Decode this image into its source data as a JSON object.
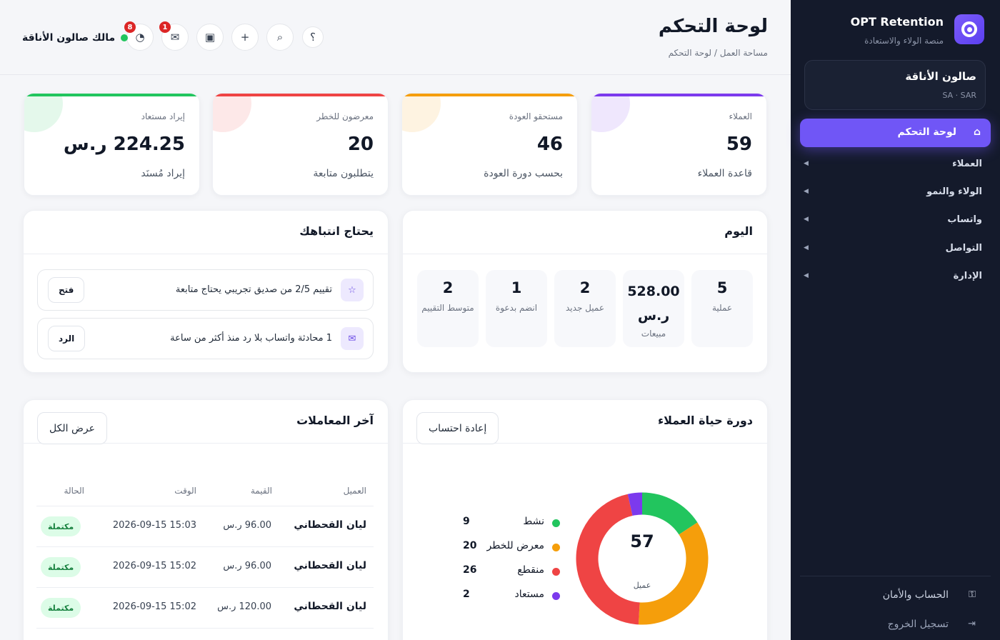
{
  "sidebar": {
    "brand_name": "OPT Retention",
    "brand_sub": "منصة الولاء والاستعادة",
    "salon_name": "صالون الأناقة",
    "salon_meta": "SA · SAR",
    "active_item": "لوحة التحكم",
    "items": [
      {
        "label": "العملاء"
      },
      {
        "label": "الولاء والنمو"
      },
      {
        "label": "واتساب"
      },
      {
        "label": "التواصل"
      },
      {
        "label": "الإدارة"
      }
    ],
    "account": "الحساب والأمان",
    "logout": "تسجيل الخروج"
  },
  "header": {
    "title": "لوحة التحكم",
    "breadcrumb": "مساحة العمل / لوحة التحكم",
    "user": "مالك صالون الأناقة",
    "badges": {
      "reports": "8",
      "mail": "1"
    }
  },
  "stats": [
    {
      "label": "العملاء",
      "value": "59",
      "sub": "قاعدة العملاء",
      "color": "#7c3aed"
    },
    {
      "label": "مستحقو العودة",
      "value": "46",
      "sub": "بحسب دورة العودة",
      "color": "#f59e0b"
    },
    {
      "label": "معرضون للخطر",
      "value": "20",
      "sub": "يتطلبون متابعة",
      "color": "#ef4444"
    },
    {
      "label": "إيراد مستعاد",
      "value": "224.25 ر.س",
      "sub": "إيراد مُسنَد",
      "color": "#22c55e"
    }
  ],
  "today": {
    "title": "اليوم",
    "tiles": [
      {
        "value": "5",
        "label": "عملية"
      },
      {
        "value": "528.00 ر.س",
        "label": "مبيعات"
      },
      {
        "value": "2",
        "label": "عميل جديد"
      },
      {
        "value": "1",
        "label": "انضم بدعوة"
      },
      {
        "value": "2",
        "label": "متوسط التقييم"
      }
    ]
  },
  "attention": {
    "title": "يحتاج انتباهك",
    "items": [
      {
        "text": "تقييم 2/5 من صديق تجريبي يحتاج متابعة",
        "action": "فتح",
        "icon": "star-icon"
      },
      {
        "text": "1 محادثة واتساب بلا رد منذ أكثر من ساعة",
        "action": "الرد",
        "icon": "mail-icon"
      }
    ]
  },
  "lifecycle": {
    "title": "دورة حياة العملاء",
    "button": "إعادة احتساب",
    "total": "57",
    "unit": "عميل",
    "segments": [
      {
        "name": "نشط",
        "count": 9,
        "color": "#22c55e"
      },
      {
        "name": "معرض للخطر",
        "count": 20,
        "color": "#f59e0b"
      },
      {
        "name": "منقطع",
        "count": 26,
        "color": "#ef4444"
      },
      {
        "name": "مستعاد",
        "count": 2,
        "color": "#7c3aed"
      }
    ]
  },
  "transactions": {
    "title": "آخر المعاملات",
    "button": "عرض الكل",
    "columns": [
      "العميل",
      "القيمة",
      "الوقت",
      "الحالة"
    ],
    "rows": [
      {
        "customer": "ليان القحطاني",
        "amount": "96.00 ر.س",
        "time": "2026-09-15 15:03",
        "status": "مكتملة"
      },
      {
        "customer": "ليان القحطاني",
        "amount": "96.00 ر.س",
        "time": "2026-09-15 15:02",
        "status": "مكتملة"
      },
      {
        "customer": "ليان القحطاني",
        "amount": "120.00 ر.س",
        "time": "2026-09-15 15:02",
        "status": "مكتملة"
      }
    ]
  }
}
